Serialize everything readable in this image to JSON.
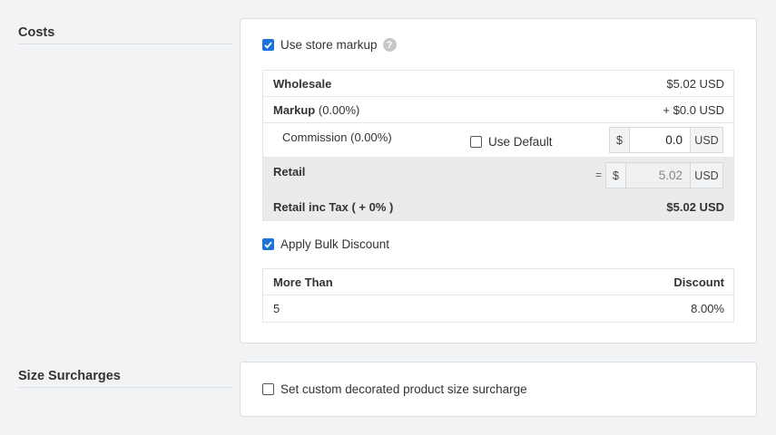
{
  "costs": {
    "section_title": "Costs",
    "use_store_markup_label": "Use store markup",
    "help_glyph": "?",
    "wholesale_label": "Wholesale",
    "wholesale_value": "$5.02 USD",
    "markup_label": "Markup",
    "markup_percent": "(0.00%)",
    "markup_value": "+ $0.0 USD",
    "commission_label": "Commission (0.00%)",
    "use_default_label": "Use Default",
    "commission_currency_symbol": "$",
    "commission_value": "0.0",
    "commission_unit": "USD",
    "retail_label": "Retail",
    "retail_equals": "=",
    "retail_currency_symbol": "$",
    "retail_value": "5.02",
    "retail_unit": "USD",
    "retail_inc_tax_label": "Retail inc Tax ( + 0% )",
    "retail_inc_tax_value": "$5.02 USD",
    "apply_bulk_discount_label": "Apply Bulk Discount",
    "discount_table": {
      "headers": [
        "More Than",
        "Discount"
      ],
      "rows": [
        [
          "5",
          "8.00%"
        ]
      ]
    }
  },
  "size_surcharges": {
    "section_title": "Size Surcharges",
    "custom_surcharge_label": "Set custom decorated product size surcharge"
  },
  "checkbox_states": {
    "use_store_markup": true,
    "use_default": false,
    "apply_bulk_discount": true,
    "custom_surcharge": false
  },
  "colors": {
    "checkbox_checked": "#1a73d9",
    "page_background": "#f2f3f5",
    "grey_row": "#ebebeb"
  }
}
